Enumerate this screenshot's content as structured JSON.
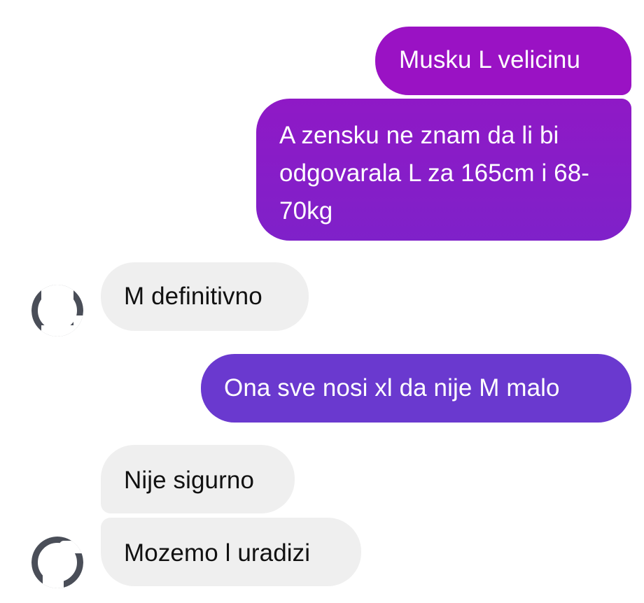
{
  "conversation": {
    "messages": [
      {
        "direction": "outgoing",
        "text": "Musku L velicinu"
      },
      {
        "direction": "outgoing",
        "text": "A zensku ne znam da li bi odgovarala L za 165cm i 68-70kg"
      },
      {
        "direction": "incoming",
        "text": "M definitivno"
      },
      {
        "direction": "outgoing",
        "text": "Ona sve nosi xl da nije M malo"
      },
      {
        "direction": "incoming",
        "text": "Nije sigurno"
      },
      {
        "direction": "incoming",
        "text": "Mozemo l uradizi"
      }
    ]
  },
  "colors": {
    "outgoing_1": "#9a12c4",
    "outgoing_2": "#8a1cc7",
    "outgoing_3": "#6a39cf",
    "incoming_bubble": "#efefef",
    "incoming_text": "#111111",
    "outgoing_text": "#ffffff"
  },
  "icons": {
    "avatar": "contact-avatar-icon"
  }
}
